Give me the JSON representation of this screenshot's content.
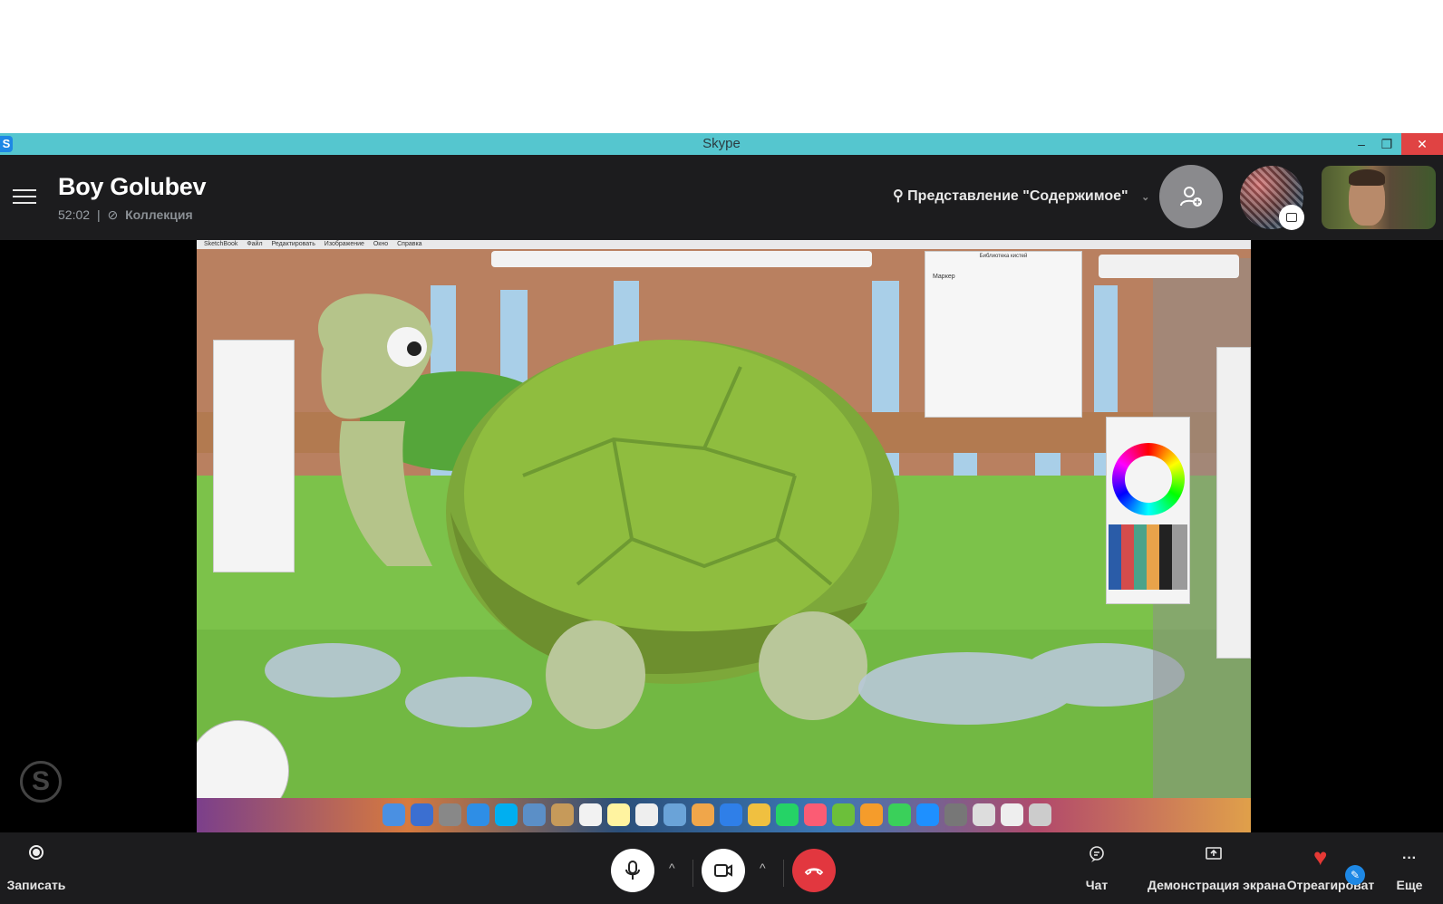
{
  "window": {
    "title": "Skype",
    "app_icon_letter": "S",
    "controls": {
      "minimize": "–",
      "restore": "❐",
      "close": "✕"
    }
  },
  "header": {
    "contact_name": "Boy Golubev",
    "call_duration": "52:02",
    "meta_separator": "|",
    "collection_label": "Коллекция",
    "view_mode_label": "Представление \"Содержимое\"",
    "icons": [
      "menu-icon",
      "view-mode-icon",
      "add-people-icon"
    ]
  },
  "shared_screen": {
    "app_menu": [
      "SketchBook",
      "Файл",
      "Редактировать",
      "Изображение",
      "Окно",
      "Справка"
    ],
    "brush_library_title": "Библиотека кистей",
    "brush_name": "Маркер"
  },
  "callbar": {
    "record_label": "Записать",
    "chat_label": "Чат",
    "share_label": "Демонстрация экрана",
    "react_label": "Отреагироват",
    "more_label": "Еще",
    "more_glyph": "···",
    "caret_glyph": "^",
    "colors": {
      "end_call": "#e2373f",
      "heart": "#e53935",
      "accent": "#1e88e5"
    }
  }
}
